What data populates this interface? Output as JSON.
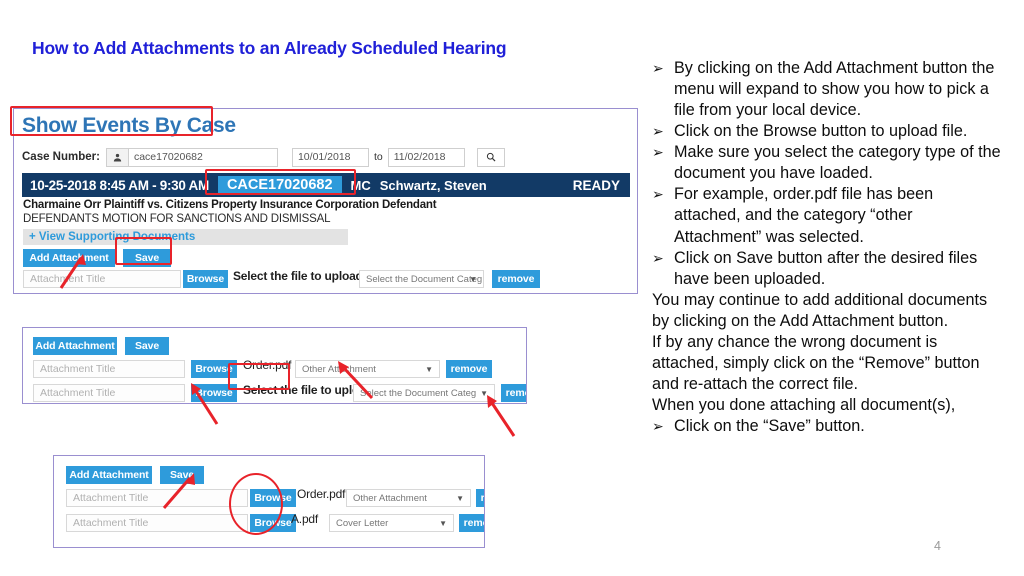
{
  "slide": {
    "title": "How to Add Attachments to an Already Scheduled Hearing",
    "page_number": "4"
  },
  "colors": {
    "title_blue": "#2020D8",
    "panel_border": "#9a8fd0",
    "button_blue": "#2E9BDB",
    "header_navy": "#123A66",
    "annotation_red": "#E8232A",
    "heading_blue": "#2E75B6"
  },
  "panel1": {
    "heading": "Show Events By Case",
    "case_number_label": "Case Number:",
    "user_icon": "user-icon",
    "case_number_value": "cace17020682",
    "date_from": "10/01/2018",
    "date_separator": "to",
    "date_to": "11/02/2018",
    "search_icon": "search-icon",
    "hearing": {
      "datetime": "10-25-2018 8:45 AM - 9:30 AM",
      "case_number": "CACE17020682",
      "division": "MC",
      "judge": "Schwartz, Steven",
      "status": "READY"
    },
    "parties": "Charmaine Orr Plaintiff vs. Citizens Property Insurance Corporation Defendant",
    "motion": "DEFENDANTS MOTION FOR SANCTIONS AND DISMISSAL",
    "supporting_documents": "+ View Supporting Documents",
    "add_attachment_label": "Add Attachment",
    "save_label": "Save",
    "attachment_title_placeholder": "Attachment Title",
    "browse_label": "Browse",
    "upload_help": "Select the file to upload.",
    "category_placeholder": "Select the Document Categ",
    "remove_label": "remove",
    "caret": "▼"
  },
  "panel2": {
    "add_attachment_label": "Add Attachment",
    "save_label": "Save",
    "rows": [
      {
        "title_placeholder": "Attachment Title",
        "browse_label": "Browse",
        "file_name": "Order.pdf",
        "category": "Other Attachment",
        "remove_label": "remove"
      },
      {
        "title_placeholder": "Attachment Title",
        "browse_label": "Browse",
        "file_name": "Select the file to upload.",
        "category": "Select the Document Categ",
        "remove_label": "remove"
      }
    ],
    "caret": "▼"
  },
  "panel3": {
    "add_attachment_label": "Add Attachment",
    "save_label": "Save",
    "rows": [
      {
        "title_placeholder": "Attachment Title",
        "browse_label": "Browse",
        "file_name": "Order.pdf",
        "category": "Other Attachment",
        "remove_label": "remove"
      },
      {
        "title_placeholder": "Attachment Title",
        "browse_label": "Browse",
        "file_name": "A.pdf",
        "category": "Cover Letter",
        "remove_label": "remove"
      }
    ],
    "caret": "▼"
  },
  "notes": {
    "marker": "➢",
    "bullets": [
      "By clicking on the Add Attachment button the menu will expand to show you how to pick a file from your local device.",
      "Click on the Browse button to upload file.",
      "Make sure you select the category type of the document you have loaded.",
      "For example, order.pdf file has been attached, and the category “other Attachment” was selected.",
      "Click on Save button after the desired files have been uploaded."
    ],
    "paragraphs": [
      "You may continue to add additional documents by clicking on the Add Attachment button.",
      "If by any chance the wrong document is attached, simply click on the “Remove” button and re-attach the correct file.",
      "When you done attaching all document(s),"
    ],
    "final_bullet": "Click on the “Save” button."
  }
}
